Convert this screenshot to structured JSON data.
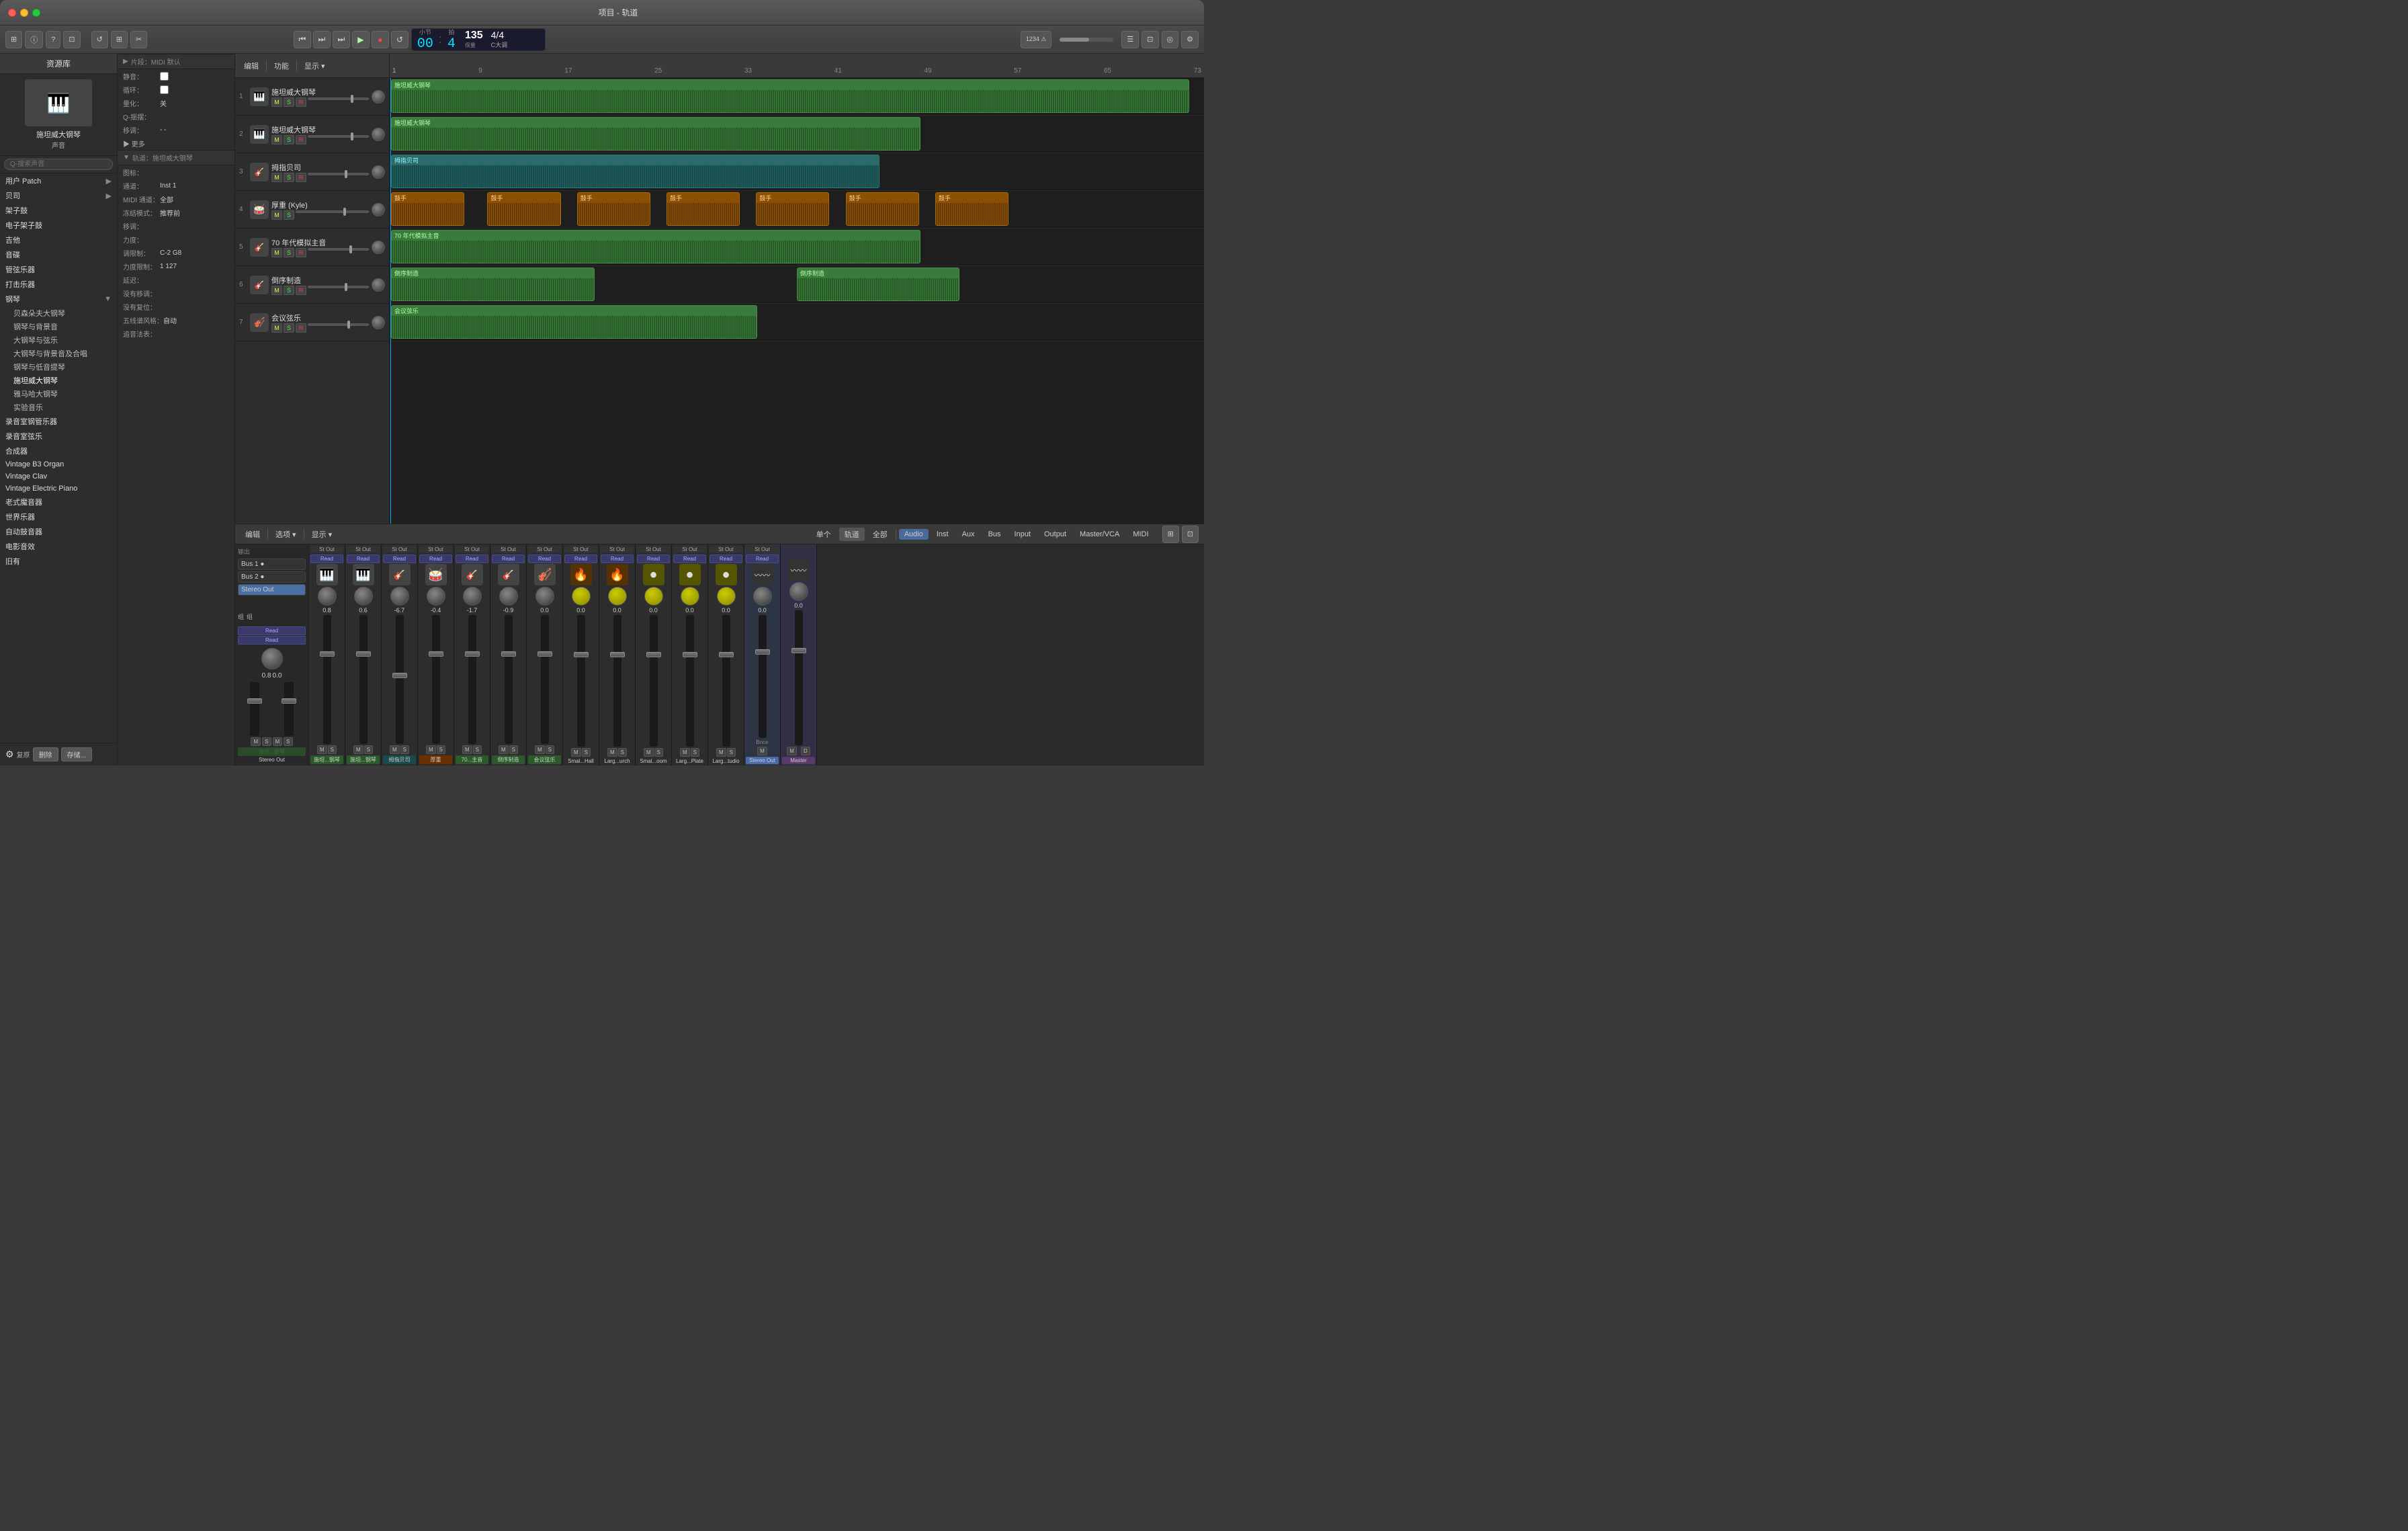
{
  "window": {
    "title": "项目 - 轨道"
  },
  "toolbar": {
    "transport": {
      "rewind": "⏮",
      "fast_forward": "⏭",
      "skip_forward": "⏭",
      "play": "▶",
      "record": "●",
      "cycle": "↺"
    },
    "time_display": "00:04",
    "bars": "0",
    "beats": "4",
    "tempo": "135",
    "time_sig": "4/4",
    "key": "C大调",
    "tempo_label": "保量",
    "master_vol": "1234"
  },
  "library": {
    "title": "资源库",
    "instrument": {
      "name": "施坦威大钢琴",
      "type": "声音"
    },
    "search_placeholder": "Q-搜索声音",
    "items": [
      {
        "label": "用户 Patch",
        "has_sub": true
      },
      {
        "label": "贝司",
        "has_sub": true
      },
      {
        "label": "架子鼓",
        "has_sub": false
      },
      {
        "label": "电子架子鼓",
        "has_sub": false
      },
      {
        "label": "吉他",
        "has_sub": false
      },
      {
        "label": "音碟",
        "has_sub": false
      },
      {
        "label": "管弦乐器",
        "has_sub": false
      },
      {
        "label": "打击乐器",
        "has_sub": false
      },
      {
        "label": "钢琴",
        "has_sub": true
      },
      {
        "label": "录音室钢管乐器",
        "has_sub": false
      },
      {
        "label": "录音室弦乐",
        "has_sub": false
      },
      {
        "label": "合成器",
        "has_sub": false
      },
      {
        "label": "Vintage B3 Organ",
        "has_sub": false
      },
      {
        "label": "Vintage Clav",
        "has_sub": false
      },
      {
        "label": "Vintage Electric Piano",
        "has_sub": false
      },
      {
        "label": "老式魔音器",
        "has_sub": false
      },
      {
        "label": "世界乐器",
        "has_sub": false
      },
      {
        "label": "自动鼓音器",
        "has_sub": false
      },
      {
        "label": "电影音效",
        "has_sub": false
      },
      {
        "label": "旧有",
        "has_sub": false
      }
    ],
    "sub_items": [
      {
        "label": "贝森朵夫大钢琴"
      },
      {
        "label": "钢琴与背景音"
      },
      {
        "label": "大钢琴与弦乐"
      },
      {
        "label": "大钢琴与背景音及合唱"
      },
      {
        "label": "钢琴与低音提琴"
      },
      {
        "label": "施坦威大钢琴",
        "active": true
      },
      {
        "label": "雅马哈大钢琴"
      },
      {
        "label": "实验音乐"
      }
    ],
    "footer": {
      "restore": "复原",
      "delete": "删除",
      "save": "存储..."
    }
  },
  "midi_settings": {
    "section_label": "▶ 片段：MIDI 默认",
    "track_label": "▼ 轨道：施坦威大钢琴",
    "fields": [
      {
        "label": "静音：",
        "value": ""
      },
      {
        "label": "循环：",
        "value": ""
      },
      {
        "label": "量化：",
        "value": "关"
      },
      {
        "label": "Q-揺摆：",
        "value": ""
      },
      {
        "label": "移调：",
        "value": "- -"
      },
      {
        "label": "力度：",
        "value": ""
      },
      {
        "label": "图标：",
        "value": ""
      },
      {
        "label": "通道：",
        "value": "Inst 1"
      },
      {
        "label": "MIDI 通道：",
        "value": "全部"
      },
      {
        "label": "冻结模式：",
        "value": "推荐前"
      },
      {
        "label": "移调：",
        "value": ""
      },
      {
        "label": "力度：",
        "value": ""
      },
      {
        "label": "调限制：",
        "value": "C-2 G8"
      },
      {
        "label": "力度限制：",
        "value": "1 127"
      },
      {
        "label": "延迟：",
        "value": ""
      },
      {
        "label": "没有移调：",
        "value": ""
      },
      {
        "label": "没有复位：",
        "value": ""
      },
      {
        "label": "五线谱风格：",
        "value": "自动"
      },
      {
        "label": "追音法表：",
        "value": ""
      }
    ]
  },
  "tracks": [
    {
      "num": 1,
      "name": "施坦威大钢琴",
      "icon": "🎹",
      "color": "green"
    },
    {
      "num": 2,
      "name": "施坦威大钢琴",
      "icon": "🎹",
      "color": "green"
    },
    {
      "num": 3,
      "name": "拇指贝司",
      "icon": "🎸",
      "color": "teal"
    },
    {
      "num": 4,
      "name": "厚重 (Kyle)",
      "icon": "🥁",
      "color": "orange"
    },
    {
      "num": 5,
      "name": "70 年代模拟主音",
      "icon": "🎸",
      "color": "green"
    },
    {
      "num": 6,
      "name": "倒序制造",
      "icon": "🎹",
      "color": "green"
    },
    {
      "num": 7,
      "name": "会议弦乐",
      "icon": "🎻",
      "color": "green"
    }
  ],
  "ruler": {
    "marks": [
      1,
      9,
      17,
      25,
      33,
      41,
      49,
      57,
      65,
      73
    ]
  },
  "mixer": {
    "tabs": [
      "单个",
      "轨道",
      "全部",
      "Audio",
      "Inst",
      "Aux",
      "Bus",
      "Input",
      "Output",
      "Master/VCA",
      "MIDI"
    ],
    "active_tab": "轨道",
    "bus_items": [
      "Bus 1",
      "Bus 2",
      "Stereo Out"
    ],
    "strips": [
      {
        "name": "施坦...钢琴",
        "db": "0.8",
        "color": "green",
        "read": true,
        "icon": "🎹"
      },
      {
        "name": "施坦...钢琴",
        "db": "0.6",
        "color": "green",
        "read": true,
        "icon": "🎹"
      },
      {
        "name": "拇指贝司",
        "db": "-6.7",
        "color": "teal",
        "read": true,
        "icon": "🎸"
      },
      {
        "name": "厚重",
        "db": "-0.4",
        "color": "orange",
        "read": true,
        "icon": "🥁"
      },
      {
        "name": "70...主音",
        "db": "-1.7",
        "color": "green",
        "read": true,
        "icon": "🎸"
      },
      {
        "name": "倒序制造",
        "db": "-0.9",
        "color": "green",
        "read": true,
        "icon": "🎸"
      },
      {
        "name": "会议弦乐",
        "db": "0.0",
        "color": "green",
        "read": true,
        "icon": "🎻"
      },
      {
        "name": "Smal...Hall",
        "db": "0.0",
        "color": "none",
        "read": true,
        "icon": "🔥"
      },
      {
        "name": "Larg...urch",
        "db": "0.0",
        "color": "none",
        "read": true,
        "icon": "🔥"
      },
      {
        "name": "Smal...oom",
        "db": "0.0",
        "color": "none",
        "read": true,
        "icon": "🟡"
      },
      {
        "name": "Larg...Plate",
        "db": "0.0",
        "color": "none",
        "read": true,
        "icon": "🟡"
      },
      {
        "name": "Larg...tudio",
        "db": "0.0",
        "color": "none",
        "read": true,
        "icon": "🟡"
      },
      {
        "name": "Stereo Out",
        "db": "0.0",
        "color": "highlight",
        "read": true,
        "icon": "〰"
      },
      {
        "name": "Master",
        "db": "0.0",
        "color": "master",
        "read": false,
        "icon": "〰"
      }
    ]
  }
}
